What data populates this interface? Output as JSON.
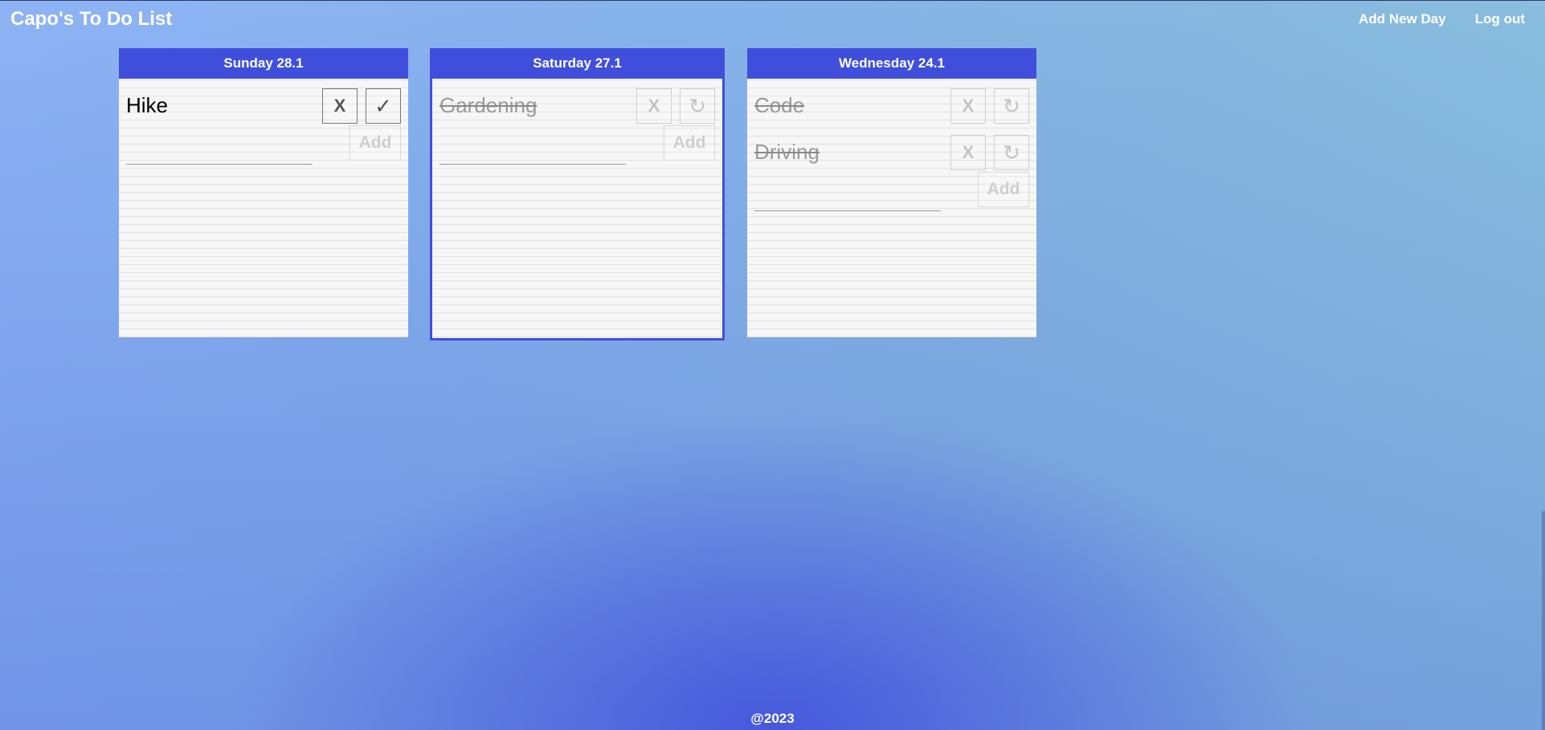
{
  "app": {
    "title": "Capo's To Do List"
  },
  "nav": {
    "add_new_day": "Add New Day",
    "log_out": "Log out"
  },
  "days": [
    {
      "header": "Sunday 28.1",
      "tasks": [
        {
          "text": "Hike",
          "delete_label": "X",
          "action_label": "✓",
          "done": false
        }
      ],
      "add_label": "Add",
      "input_value": ""
    },
    {
      "header": "Saturday 27.1",
      "selected": true,
      "tasks": [
        {
          "text": "Gardening",
          "delete_label": "X",
          "action_label": "↻",
          "done": true
        }
      ],
      "add_label": "Add",
      "input_value": ""
    },
    {
      "header": "Wednesday 24.1",
      "tasks": [
        {
          "text": "Code",
          "delete_label": "X",
          "action_label": "↻",
          "done": true
        },
        {
          "text": "Driving",
          "delete_label": "X",
          "action_label": "↻",
          "done": true
        }
      ],
      "add_label": "Add",
      "input_value": ""
    }
  ],
  "footer": {
    "text": "@2023"
  },
  "colors": {
    "accent": "#3f4fdc",
    "card_background": "#f6f6f6"
  }
}
